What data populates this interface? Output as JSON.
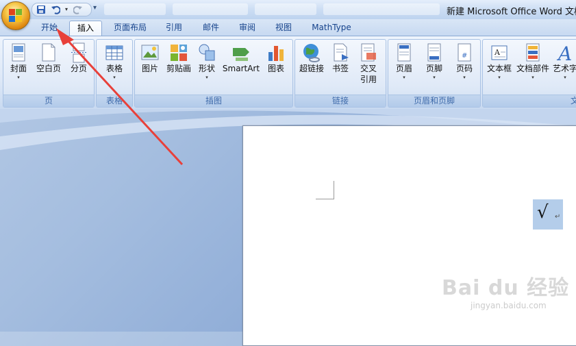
{
  "title_bar": {
    "doc_title": "新建 Microsoft Office Word 文档"
  },
  "quick_access": {
    "icons": [
      "save-icon",
      "undo-icon",
      "redo-icon",
      "customize-icon"
    ]
  },
  "tabs": [
    {
      "label": "开始",
      "active": false
    },
    {
      "label": "插入",
      "active": true
    },
    {
      "label": "页面布局",
      "active": false
    },
    {
      "label": "引用",
      "active": false
    },
    {
      "label": "邮件",
      "active": false
    },
    {
      "label": "审阅",
      "active": false
    },
    {
      "label": "视图",
      "active": false
    },
    {
      "label": "MathType",
      "active": false
    }
  ],
  "groups": {
    "pages": {
      "label": "页",
      "buttons": [
        "封面",
        "空白页",
        "分页"
      ]
    },
    "table": {
      "label": "表格",
      "buttons": [
        "表格"
      ]
    },
    "illustrations": {
      "label": "插图",
      "buttons": [
        "图片",
        "剪贴画",
        "形状",
        "SmartArt",
        "图表"
      ]
    },
    "links": {
      "label": "链接",
      "buttons": [
        "超链接",
        "书签",
        "交叉",
        "引用"
      ]
    },
    "header_footer": {
      "label": "页眉和页脚",
      "buttons": [
        "页眉",
        "页脚",
        "页码"
      ]
    },
    "text": {
      "label": "文",
      "buttons": [
        "文本框",
        "文档部件",
        "艺术字"
      ]
    }
  },
  "document": {
    "symbol": "√",
    "para_mark": "↵"
  },
  "watermark": {
    "main": "Bai du 经验",
    "sub": "jingyan.baidu.com"
  },
  "colors": {
    "annotation_arrow": "#e8403a",
    "ribbon_blue": "#15428b",
    "selection": "#b4cdea"
  }
}
